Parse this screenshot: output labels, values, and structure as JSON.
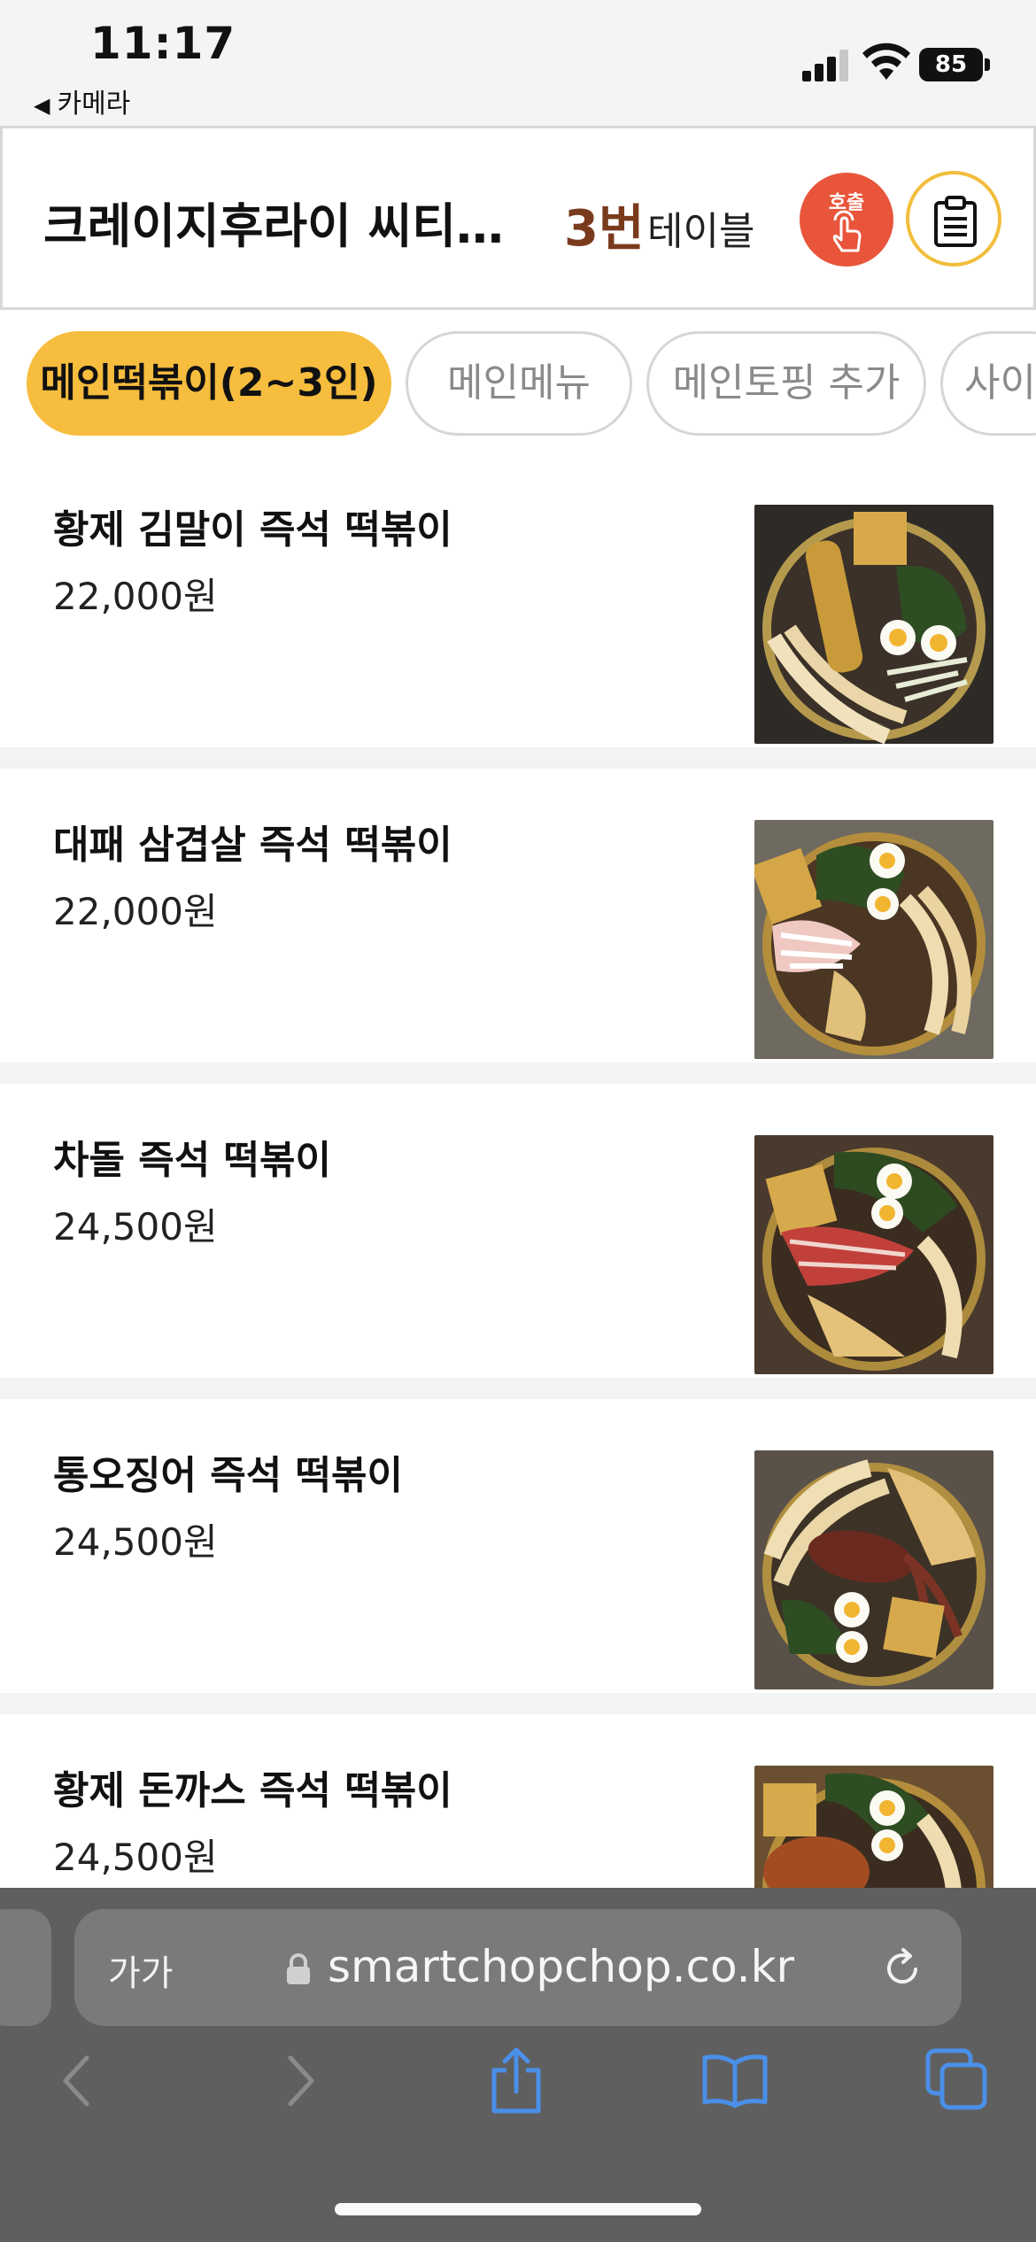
{
  "status_bar": {
    "time": "11:17",
    "back_app": "카메라",
    "battery": "85"
  },
  "header": {
    "store_name": "크레이지후라이 씨티…",
    "table_number": "3번",
    "table_label": "테이블",
    "call_button_label": "호출",
    "call_icon": "hand-tap-icon",
    "order_icon": "clipboard-icon"
  },
  "tabs": [
    {
      "label": "메인떡볶이(2~3인)",
      "active": true
    },
    {
      "label": "메인메뉴",
      "active": false
    },
    {
      "label": "메인토핑 추가",
      "active": false
    },
    {
      "label": "사이",
      "active": false
    }
  ],
  "menu_items": [
    {
      "name": "황제 김말이 즉석 떡볶이",
      "price": "22,000원"
    },
    {
      "name": "대패 삼겹살 즉석 떡볶이",
      "price": "22,000원"
    },
    {
      "name": "차돌 즉석 떡볶이",
      "price": "24,500원"
    },
    {
      "name": "통오징어 즉석 떡볶이",
      "price": "24,500원"
    },
    {
      "name": "황제 돈까스 즉석 떡볶이",
      "price": "24,500원"
    }
  ],
  "browser": {
    "text_size_label": "가가",
    "url": "smartchopchop.co.kr",
    "toolbar_icons": [
      "back-icon",
      "forward-icon",
      "share-icon",
      "bookmarks-icon",
      "tabs-icon"
    ]
  },
  "colors": {
    "accent": "#f6bd3e",
    "call_red": "#e8553a",
    "table_brown": "#7a3b1d"
  }
}
